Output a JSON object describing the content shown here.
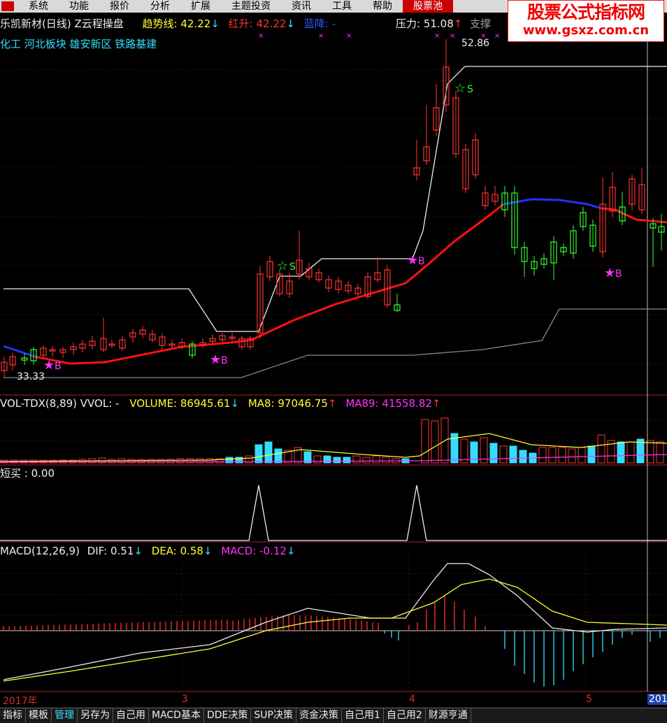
{
  "menu": {
    "items": [
      "系统",
      "功能",
      "报价",
      "分析",
      "扩展",
      "主题投资",
      "资讯",
      "工具",
      "帮助",
      "股票池"
    ],
    "highlight_index": 9
  },
  "watermark": {
    "line1": "股票公式指标网",
    "line2": "www.gsxz.com.cn"
  },
  "main": {
    "title": "乐凯新材(日线) Z云程操盘",
    "trend_label": "趋势线: 42.22",
    "red_label": "红升: 42.22",
    "blue_label": "蓝降: -",
    "pressure_label": "压力: 51.08",
    "support_label": "支撑",
    "sectors": "化工 河北板块 雄安新区 铁路基建",
    "high_mark": "52.86",
    "low_mark": "33.33",
    "buy_label": "B",
    "sell_label": "S"
  },
  "vol": {
    "title": "VOL-TDX(8,89) VVOL: -",
    "volume": "VOLUME: 86945.61",
    "ma8": "MA8: 97046.75",
    "ma89": "MA89: 41558.82"
  },
  "short": {
    "label": "短买 : 0.00"
  },
  "macd": {
    "title": "MACD(12,26,9)",
    "dif": "DIF: 0.51",
    "dea": "DEA: 0.58",
    "macd": "MACD: -0.12"
  },
  "dates": [
    "2017年",
    "3",
    "4",
    "5",
    "201"
  ],
  "tabs": [
    "指标",
    "模板",
    "管理",
    "另存为",
    "自己用",
    "MACD基本",
    "DDE决策",
    "SUP决策",
    "资金决策",
    "自己用1",
    "自己用2",
    "财源亨通"
  ],
  "active_tab": 2,
  "colors": {
    "up": "#ff3333",
    "down": "#33ff33",
    "trend_red": "#ff1111",
    "trend_blue": "#2233ff",
    "cyan": "#33ddff",
    "magenta": "#ff33ff",
    "yellow": "#ffff33"
  },
  "chart_data": [
    {
      "type": "candlestick",
      "title": "乐凯新材(日线) Z云程操盘",
      "price_marks": {
        "high": 52.86,
        "low": 33.33
      },
      "indicators": {
        "趋势线": 42.22,
        "红升": 42.22,
        "压力": 51.08
      },
      "signals": [
        "B",
        "B",
        "S",
        "B",
        "S",
        "B"
      ]
    },
    {
      "type": "bar",
      "title": "VOL-TDX(8,89)",
      "values_shown": {
        "VOLUME": 86945.61,
        "MA8": 97046.75,
        "MA89": 41558.82
      }
    },
    {
      "type": "line",
      "title": "短买",
      "values_shown": {
        "短买": 0.0
      }
    },
    {
      "type": "line",
      "title": "MACD(12,26,9)",
      "values_shown": {
        "DIF": 0.51,
        "DEA": 0.58,
        "MACD": -0.12
      }
    }
  ]
}
